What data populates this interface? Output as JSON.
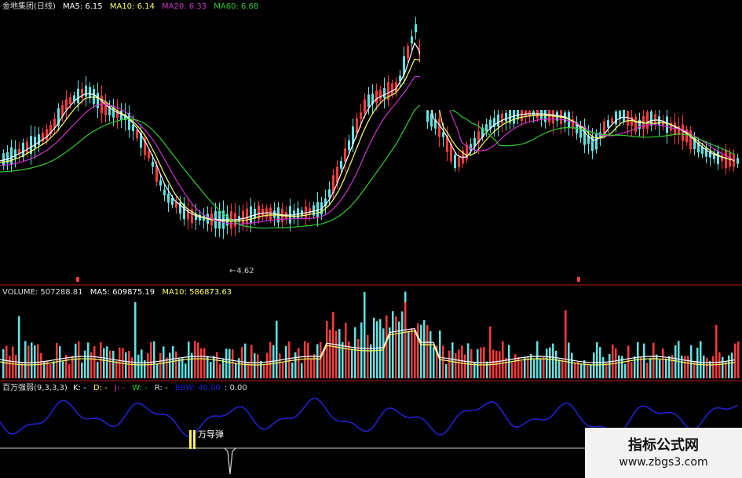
{
  "price_panel": {
    "stock_name": "金地集团(日线)",
    "ma5": "MA5: 6.15",
    "ma10": "MA10: 6.14",
    "ma20": "MA20: 6.33",
    "ma60": "MA60: 6.68",
    "low_marker": "4.62"
  },
  "volume_panel": {
    "volume": "VOLUME: 507288.81",
    "ma5": "MA5: 609875.19",
    "ma10": "MA10: 586873.63"
  },
  "indicator_panel": {
    "name": "百万强弱(9,3,3,3)",
    "k": "K: -",
    "d": "D: -",
    "j": "J: -",
    "w": "W: -",
    "r": "R: -",
    "hidden": "BBW: 40.00",
    "value": ": 0.00",
    "signal_label": "万导弹"
  },
  "watermark": {
    "title": "指标公式网",
    "url": "www.zbgs3.com"
  },
  "colors": {
    "background": "#000000",
    "up": "#ff3b3b",
    "down": "#5fe3e3",
    "ma5": "#ffffff",
    "ma10": "#ffff66",
    "ma20": "#cc33cc",
    "ma60": "#33cc33",
    "kdj": "#2222cc",
    "divider": "#7a1010"
  }
}
